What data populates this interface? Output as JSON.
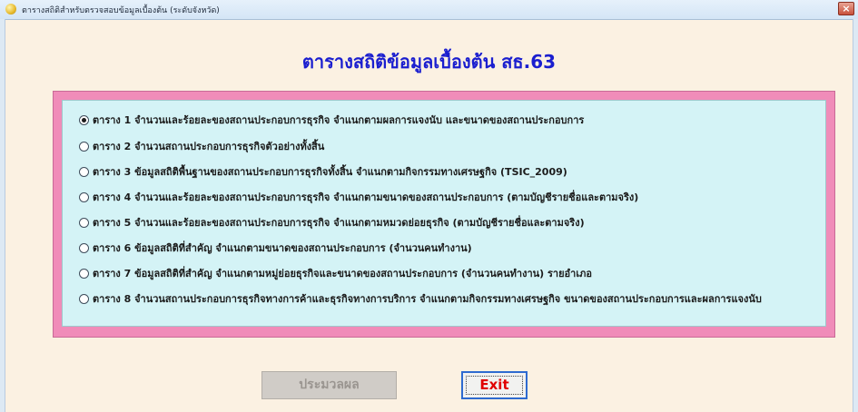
{
  "window": {
    "title": "ตารางสถิติสำหรับตรวจสอบข้อมูลเบื้องต้น (ระดับจังหวัด)",
    "close_label": "×"
  },
  "heading": "ตารางสถิติข้อมูลเบื้องต้น  สธ.63",
  "options": [
    {
      "label": "ตาราง 1  จำนวนและร้อยละของสถานประกอบการธุรกิจ  จำแนกตามผลการแจงนับ  และขนาดของสถานประกอบการ",
      "selected": true
    },
    {
      "label": "ตาราง 2  จำนวนสถานประกอบการธุรกิจตัวอย่างทั้งสิ้น",
      "selected": false
    },
    {
      "label": "ตาราง 3  ข้อมูลสถิติพื้นฐานของสถานประกอบการธุรกิจทั้งสิ้น  จำแนกตามกิจกรรมทางเศรษฐกิจ (TSIC_2009)",
      "selected": false
    },
    {
      "label": "ตาราง 4  จำนวนและร้อยละของสถานประกอบการธุรกิจ  จำแนกตามขนาดของสถานประกอบการ (ตามบัญชีรายชื่อและตามจริง)",
      "selected": false
    },
    {
      "label": "ตาราง 5  จำนวนและร้อยละของสถานประกอบการธุรกิจ  จำแนกตามหมวดย่อยธุรกิจ (ตามบัญชีรายชื่อและตามจริง)",
      "selected": false
    },
    {
      "label": "ตาราง 6  ข้อมูลสถิติที่สำคัญ  จำแนกตามขนาดของสถานประกอบการ (จำนวนคนทำงาน)",
      "selected": false
    },
    {
      "label": "ตาราง 7  ข้อมูลสถิติที่สำคัญ  จำแนกตามหมู่ย่อยธุรกิจและขนาดของสถานประกอบการ (จำนวนคนทำงาน)  รายอำเภอ",
      "selected": false
    },
    {
      "label": "ตาราง 8  จำนวนสถานประกอบการธุรกิจทางการค้าและธุรกิจทางการบริการ  จำแนกตามกิจกรรมทางเศรษฐกิจ  ขนาดของสถานประกอบการและผลการแจงนับ",
      "selected": false
    }
  ],
  "buttons": {
    "process_label": "ประมวลผล",
    "exit_label": "Exit"
  }
}
